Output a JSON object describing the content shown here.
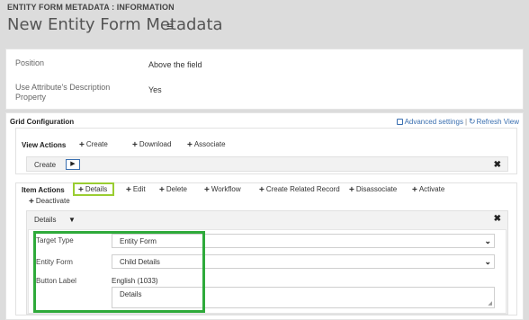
{
  "header": {
    "breadcrumb": "ENTITY FORM METADATA : INFORMATION",
    "title": "New Entity Form Metadata",
    "menu_glyph": "≡"
  },
  "properties": {
    "position_label": "Position",
    "position_value": "Above the field",
    "use_attr_label": "Use Attribute's Description Property",
    "use_attr_value": "Yes"
  },
  "grid": {
    "title": "Grid Configuration",
    "advanced_settings": "Advanced settings",
    "separator": "|",
    "refresh_view": "Refresh View",
    "view_actions": {
      "label": "View Actions",
      "buttons": [
        "Create",
        "Download",
        "Associate"
      ],
      "bar_label": "Create",
      "bar_close": "✖"
    },
    "item_actions": {
      "label": "Item Actions",
      "buttons": [
        "Details",
        "Edit",
        "Delete",
        "Workflow",
        "Create Related Record",
        "Disassociate",
        "Activate",
        "Deactivate"
      ],
      "bar_label": "Details",
      "bar_close": "✖"
    },
    "details_form": {
      "target_type_label": "Target Type",
      "target_type_value": "Entity Form",
      "entity_form_label": "Entity Form",
      "entity_form_value": "Child Details",
      "button_label_label": "Button Label",
      "button_label_lang": "English (1033)",
      "button_label_value": "Details"
    }
  },
  "colors": {
    "highlight_button_border": "#9acd32",
    "highlight_form_border": "#2eaa3a",
    "link": "#3a6fb0"
  }
}
